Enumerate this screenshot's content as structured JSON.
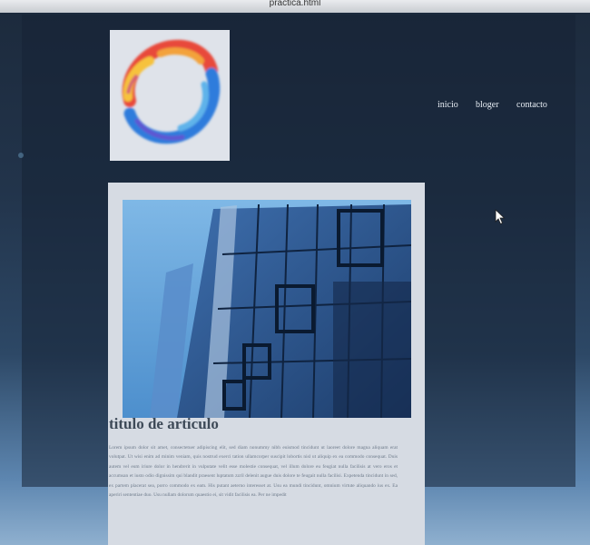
{
  "browser": {
    "address_text": "practica.html"
  },
  "nav": {
    "items": [
      "inicio",
      "bloger",
      "contacto"
    ]
  },
  "article": {
    "title": "titulo de articulo",
    "body": "Lorem ipsum dolor sit amet, consectetuer adipiscing elit, sed diam nonummy nibh euismod tincidunt ut laoreet dolore magna aliquam erat volutpat. Ut wisi enim ad minim veniam, quis nostrud exerci tation ullamcorper suscipit lobortis nisl ut aliquip ex ea commodo consequat. Duis autem vel eum iriure dolor in hendrerit in vulputate velit esse molestie consequat, vel illum dolore eu feugiat nulla facilisis at vero eros et accumsan et iusto odio dignissim qui blandit praesent luptatum zzril delenit augue duis dolore te feugait nulla facilisi. Expetenda tincidunt in sed, ex partem placerat sea, porro commodo ex eam. His putant aeterno interesset at. Usu ea mundi tincidunt, omnium virtute aliquando ius ex. Ea aperiri sententiae duo. Usu nullam dolorum quaestio ei, sit vidit facilisis ea. Per ne impedit"
  },
  "icons": {
    "logo": "watercolor-ring-logo",
    "cursor": "mouse-pointer-icon"
  },
  "colors": {
    "background": "#22344b",
    "article_card": "#d6dbe3",
    "nav_text": "#e8eef5"
  }
}
